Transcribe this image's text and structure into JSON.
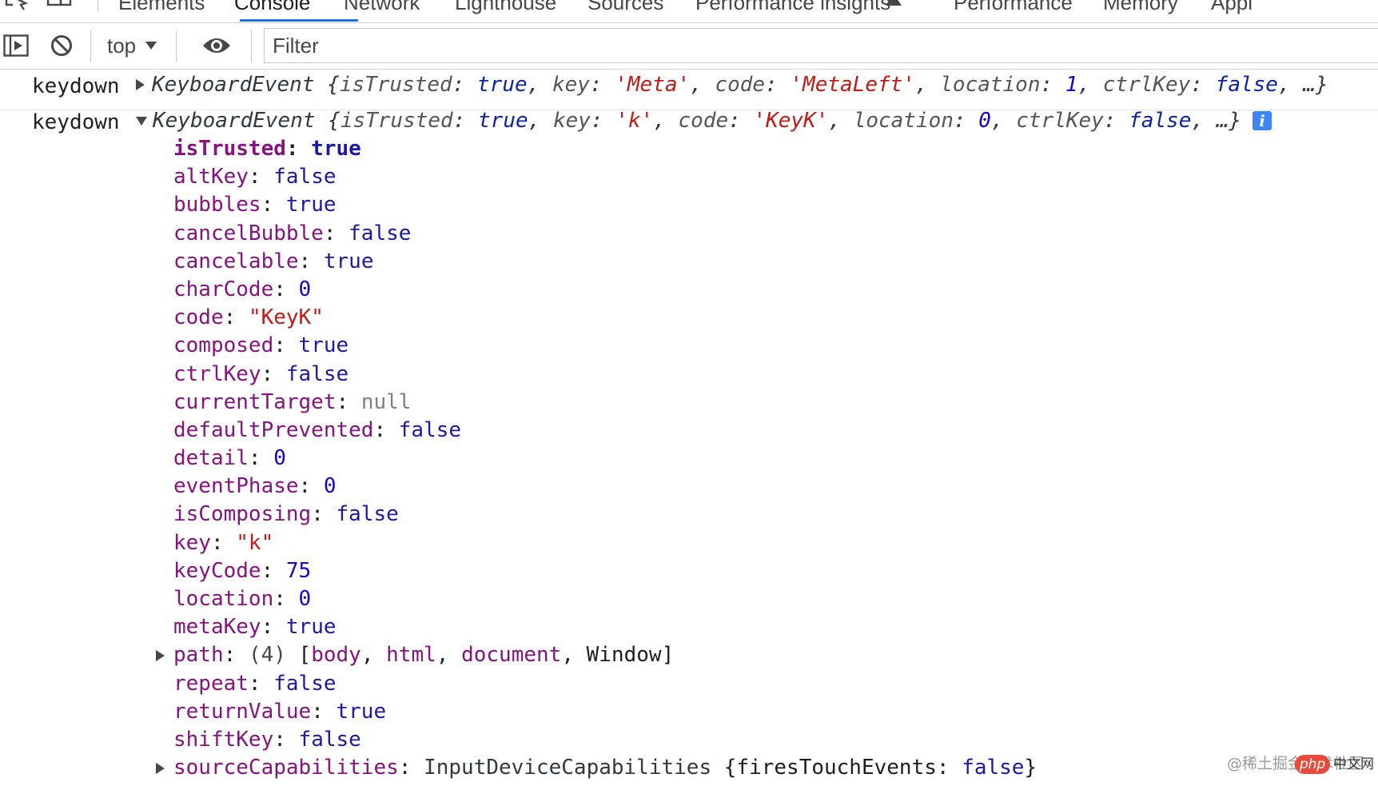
{
  "tabs": [
    {
      "label": "Elements",
      "active": false
    },
    {
      "label": "Console",
      "active": true
    },
    {
      "label": "Network",
      "active": false
    },
    {
      "label": "Lighthouse",
      "active": false
    },
    {
      "label": "Sources",
      "active": false
    },
    {
      "label": "Performance insights",
      "active": false
    },
    {
      "label": "Performance",
      "active": false
    },
    {
      "label": "Memory",
      "active": false
    },
    {
      "label": "Appl",
      "active": false
    }
  ],
  "toolbar": {
    "context": "top",
    "filter_placeholder": "Filter",
    "icons": [
      "sidebar-toggle-icon",
      "clear-console-icon",
      "eye-icon"
    ]
  },
  "messages": [
    {
      "label": "keydown",
      "expanded": false,
      "class_name": "KeyboardEvent",
      "preview": [
        {
          "key": "isTrusted",
          "value": "true",
          "type": "bool"
        },
        {
          "key": "key",
          "value": "'Meta'",
          "type": "str"
        },
        {
          "key": "code",
          "value": "'MetaLeft'",
          "type": "str"
        },
        {
          "key": "location",
          "value": "1",
          "type": "num"
        },
        {
          "key": "ctrlKey",
          "value": "false",
          "type": "bool"
        }
      ],
      "ellipsis": "…}"
    },
    {
      "label": "keydown",
      "expanded": true,
      "class_name": "KeyboardEvent",
      "preview": [
        {
          "key": "isTrusted",
          "value": "true",
          "type": "bool"
        },
        {
          "key": "key",
          "value": "'k'",
          "type": "str"
        },
        {
          "key": "code",
          "value": "'KeyK'",
          "type": "str"
        },
        {
          "key": "location",
          "value": "0",
          "type": "num"
        },
        {
          "key": "ctrlKey",
          "value": "false",
          "type": "bool"
        }
      ],
      "ellipsis": "…}",
      "info_badge": "i",
      "properties": [
        {
          "key": "isTrusted",
          "value": "true",
          "type": "bool",
          "own": true
        },
        {
          "key": "altKey",
          "value": "false",
          "type": "bool"
        },
        {
          "key": "bubbles",
          "value": "true",
          "type": "bool"
        },
        {
          "key": "cancelBubble",
          "value": "false",
          "type": "bool"
        },
        {
          "key": "cancelable",
          "value": "true",
          "type": "bool"
        },
        {
          "key": "charCode",
          "value": "0",
          "type": "num"
        },
        {
          "key": "code",
          "value": "\"KeyK\"",
          "type": "str"
        },
        {
          "key": "composed",
          "value": "true",
          "type": "bool"
        },
        {
          "key": "ctrlKey",
          "value": "false",
          "type": "bool"
        },
        {
          "key": "currentTarget",
          "value": "null",
          "type": "null"
        },
        {
          "key": "defaultPrevented",
          "value": "false",
          "type": "bool"
        },
        {
          "key": "detail",
          "value": "0",
          "type": "num"
        },
        {
          "key": "eventPhase",
          "value": "0",
          "type": "num"
        },
        {
          "key": "isComposing",
          "value": "false",
          "type": "bool"
        },
        {
          "key": "key",
          "value": "\"k\"",
          "type": "str"
        },
        {
          "key": "keyCode",
          "value": "75",
          "type": "num"
        },
        {
          "key": "location",
          "value": "0",
          "type": "num"
        },
        {
          "key": "metaKey",
          "value": "true",
          "type": "bool"
        },
        {
          "key": "path",
          "type": "array",
          "expandable": true,
          "count": "(4)",
          "items": [
            "body",
            "html",
            "document",
            "Window"
          ]
        },
        {
          "key": "repeat",
          "value": "false",
          "type": "bool"
        },
        {
          "key": "returnValue",
          "value": "true",
          "type": "bool"
        },
        {
          "key": "shiftKey",
          "value": "false",
          "type": "bool"
        },
        {
          "key": "sourceCapabilities",
          "type": "object",
          "expandable": true,
          "class_name": "InputDeviceCapabilities",
          "preview_key": "firesTouchEvents",
          "preview_value": "false"
        }
      ]
    }
  ],
  "watermark": {
    "text": "@稀土掘金技术社区",
    "badge": "php",
    "suffix": "中文网"
  },
  "colors": {
    "accent": "#1a73e8",
    "property_key": "#881280",
    "string_value": "#c41a16",
    "keyword_value": "#1a1aa6",
    "info_badge": "#3b86f7"
  }
}
